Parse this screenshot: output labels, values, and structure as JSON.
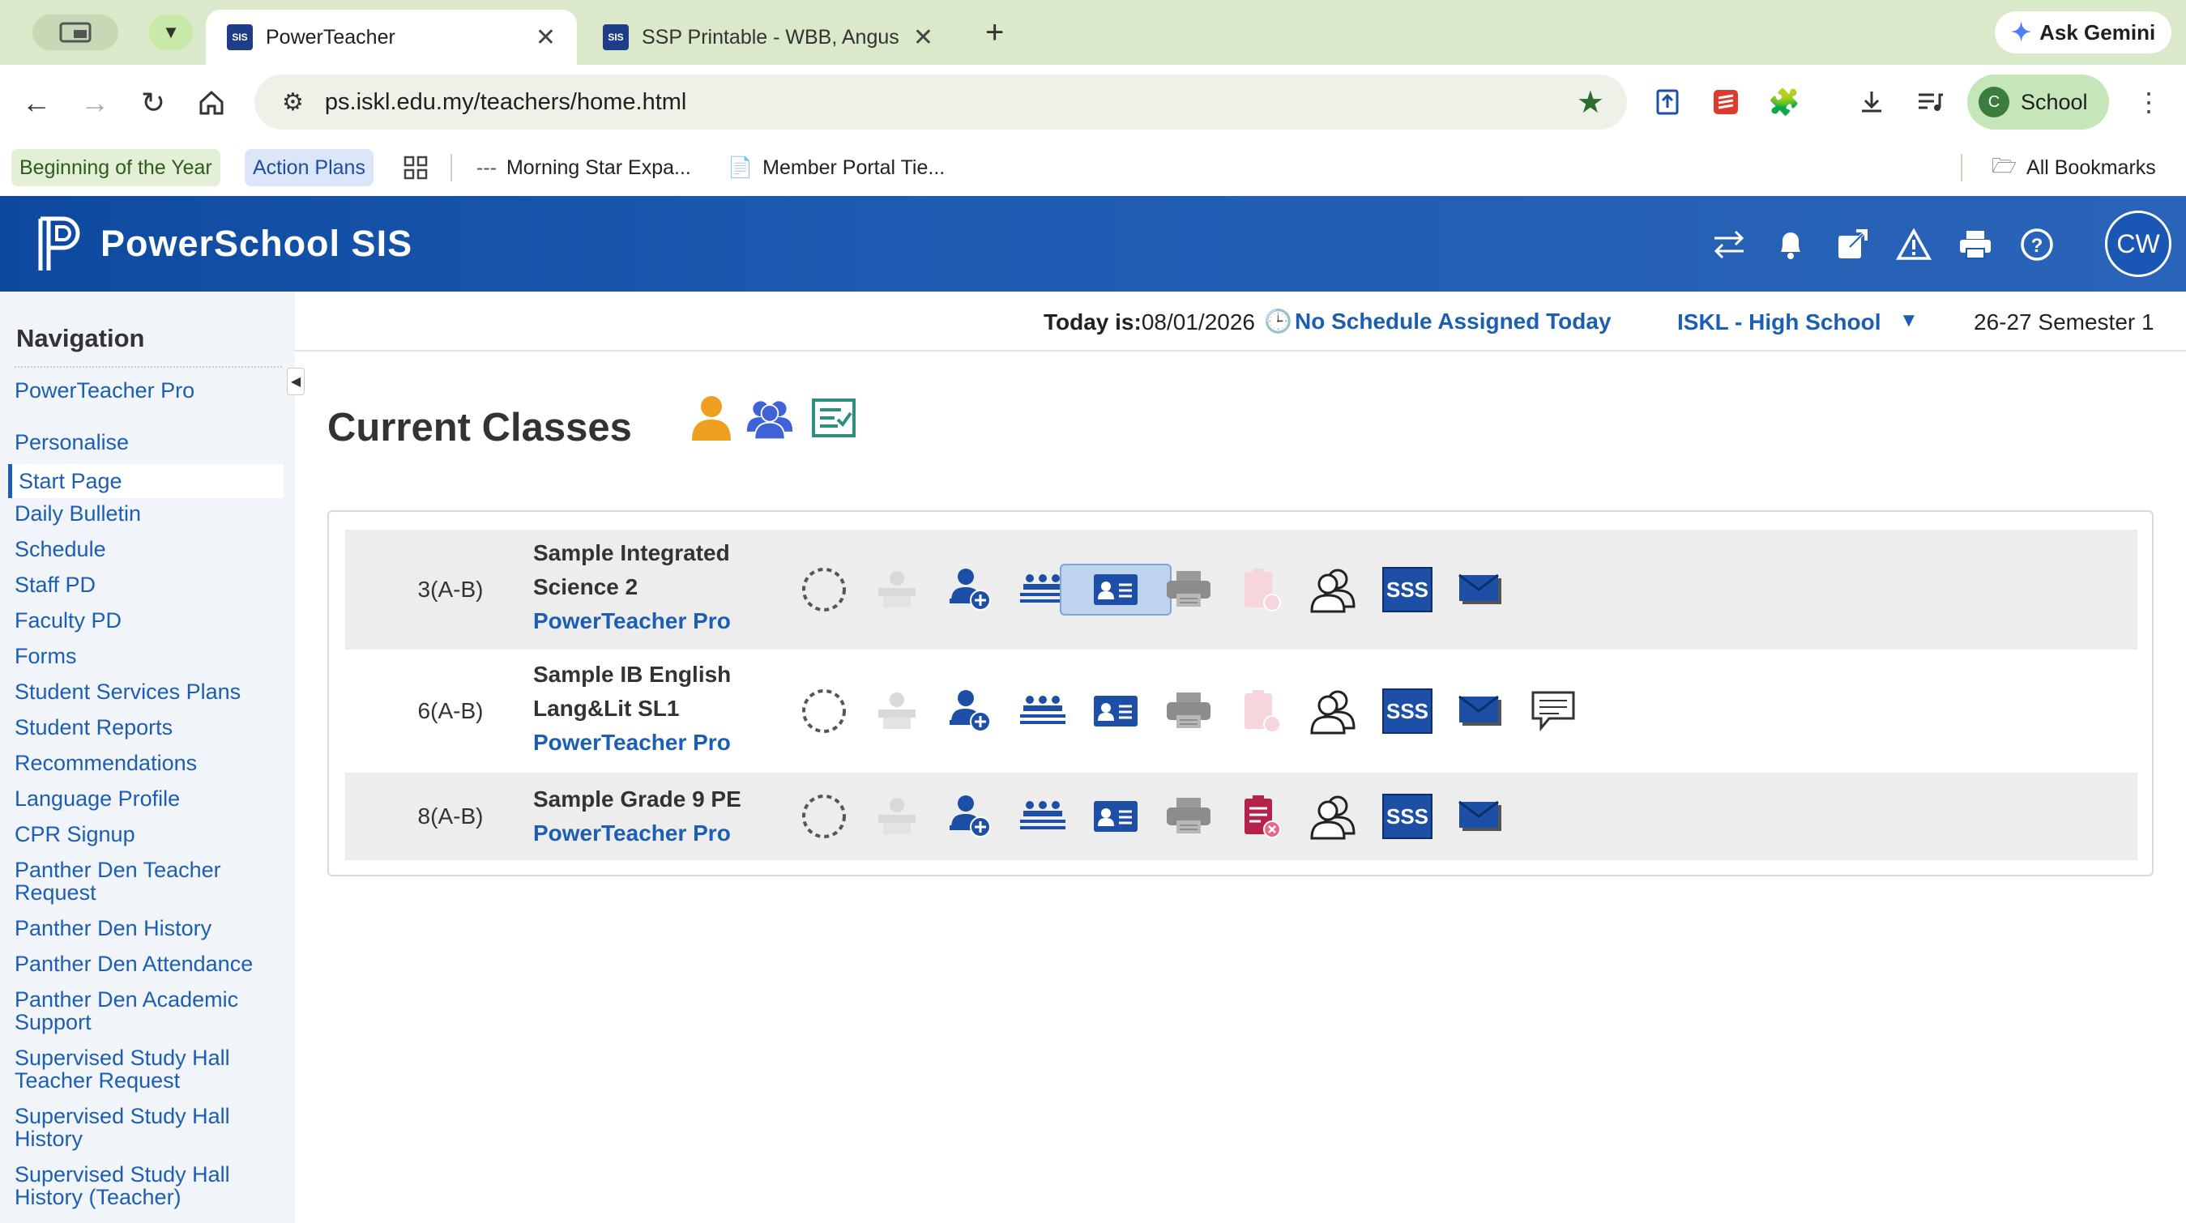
{
  "browser": {
    "tabs": [
      {
        "label": "PowerTeacher",
        "favicon": "SIS",
        "active": true
      },
      {
        "label": "SSP Printable - WBB, Angus M",
        "favicon": "SIS",
        "active": false
      }
    ],
    "gemini_label": "Ask Gemini",
    "url": "ps.iskl.edu.my/teachers/home.html",
    "profile_label": "School",
    "profile_initial": "C",
    "bookmarks": [
      {
        "label": "Beginning of the Year",
        "style": "green"
      },
      {
        "label": "Action Plans",
        "style": "blue"
      },
      {
        "label": "Morning Star Expa...",
        "style": "plain"
      },
      {
        "label": "Member Portal Tie...",
        "style": "plain"
      }
    ],
    "all_bookmarks_label": "All Bookmarks"
  },
  "header": {
    "brand": "PowerSchool SIS",
    "user_initials": "CW",
    "icons": [
      "switch-icon",
      "bell-icon",
      "external-link-icon",
      "alert-icon",
      "print-icon",
      "help-icon"
    ]
  },
  "sidebar": {
    "heading": "Navigation",
    "items": [
      {
        "label": "PowerTeacher Pro"
      },
      {
        "label": "Personalise"
      },
      {
        "label": "Start Page",
        "active": true
      },
      {
        "label": "Daily Bulletin"
      },
      {
        "label": "Schedule"
      },
      {
        "label": "Staff PD"
      },
      {
        "label": "Faculty PD"
      },
      {
        "label": "Forms"
      },
      {
        "label": "Student Services Plans"
      },
      {
        "label": "Student Reports"
      },
      {
        "label": "Recommendations"
      },
      {
        "label": "Language Profile"
      },
      {
        "label": "CPR Signup"
      },
      {
        "label": "Panther Den Teacher Request"
      },
      {
        "label": "Panther Den History"
      },
      {
        "label": "Panther Den Attendance"
      },
      {
        "label": "Panther Den Academic Support"
      },
      {
        "label": "Supervised Study Hall Teacher Request"
      },
      {
        "label": "Supervised Study Hall History"
      },
      {
        "label": "Supervised Study Hall History (Teacher)"
      }
    ]
  },
  "infobar": {
    "today_label": "Today is:",
    "today_date": "08/01/2026",
    "schedule_status": "No Schedule Assigned Today",
    "school": "ISKL - High School",
    "term": "26-27 Semester 1"
  },
  "main": {
    "title": "Current Classes",
    "sss_label": "SSS",
    "classes": [
      {
        "period": "3(A-B)",
        "course": "Sample Integrated Science 2",
        "link": "PowerTeacher Pro",
        "has_comment": false,
        "referral_active": false,
        "selected_card": true
      },
      {
        "period": "6(A-B)",
        "course": "Sample IB English Lang&Lit SL1",
        "link": "PowerTeacher Pro",
        "has_comment": true,
        "referral_active": false,
        "selected_card": false
      },
      {
        "period": "8(A-B)",
        "course": "Sample Grade 9 PE",
        "link": "PowerTeacher Pro",
        "has_comment": false,
        "referral_active": true,
        "selected_card": false
      }
    ]
  },
  "colors": {
    "brand_blue": "#1b5eb3",
    "header_blue": "#0d4a9f",
    "sss_blue": "#1c4fa5",
    "referral_red": "#b5224a"
  }
}
